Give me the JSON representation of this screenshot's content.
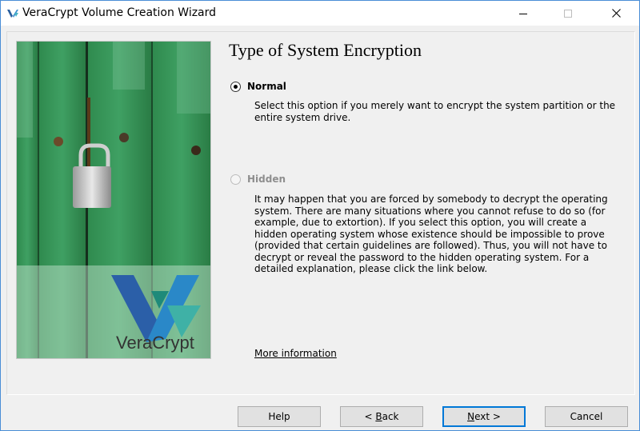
{
  "window": {
    "title": "VeraCrypt Volume Creation Wizard",
    "accent": "#0078d7"
  },
  "brand": {
    "name": "VeraCrypt"
  },
  "main": {
    "heading": "Type of System Encryption",
    "options": [
      {
        "label": "Normal",
        "selected": true,
        "enabled": true,
        "description": "Select this option if you merely want to encrypt the system partition or the entire system drive."
      },
      {
        "label": "Hidden",
        "selected": false,
        "enabled": false,
        "description": "It may happen that you are forced by somebody to decrypt the operating system. There are many situations where you cannot refuse to do so (for example, due to extortion). If you select this option, you will create a hidden operating system whose existence should be impossible to prove (provided that certain guidelines are followed). Thus, you will not have to decrypt or reveal the password to the hidden operating system. For a detailed explanation, please click the link below."
      }
    ],
    "link": "More information"
  },
  "buttons": {
    "help": "Help",
    "back_prefix": "< ",
    "back_mnemonic": "B",
    "back_rest": "ack",
    "next_mnemonic": "N",
    "next_rest": "ext >",
    "cancel": "Cancel"
  }
}
